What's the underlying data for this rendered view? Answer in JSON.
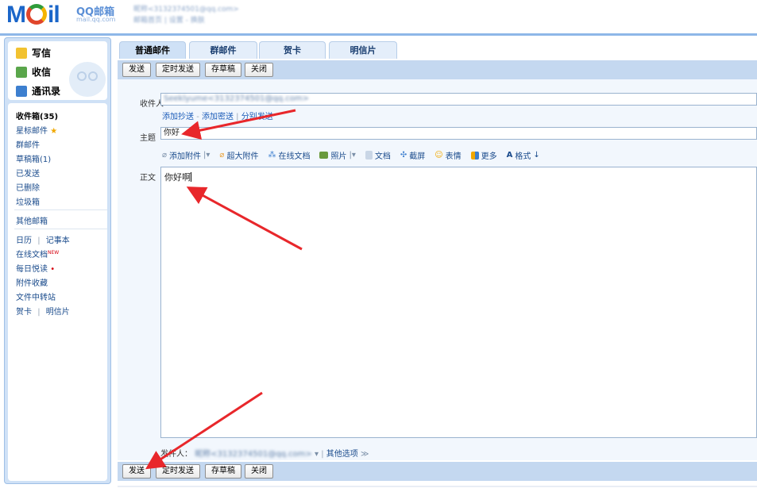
{
  "header": {
    "logo_text": "Mail",
    "logo_sub": "QQ邮箱",
    "logo_sub2": "mail.qq.com",
    "account": "昵称<3132374501@qq.com>",
    "account_links": "邮箱首页 | 设置 - 换肤"
  },
  "sidebar": {
    "compose": "写信",
    "inbox_btn": "收信",
    "contacts": "通讯录",
    "items": [
      {
        "label": "收件箱(35)"
      },
      {
        "label": "星标邮件"
      },
      {
        "label": "群邮件"
      },
      {
        "label": "草稿箱(1)"
      },
      {
        "label": "已发送"
      },
      {
        "label": "已删除"
      },
      {
        "label": "垃圾箱"
      },
      {
        "label": "其他邮箱"
      },
      {
        "label": "日历"
      },
      {
        "label": "记事本"
      },
      {
        "label": "在线文档"
      },
      {
        "label": "每日悦读"
      },
      {
        "label": "附件收藏"
      },
      {
        "label": "文件中转站"
      },
      {
        "label": "贺卡"
      },
      {
        "label": "明信片"
      }
    ],
    "new_badge": "NEW",
    "divider": "|"
  },
  "tabs": [
    "普通邮件",
    "群邮件",
    "贺卡",
    "明信片"
  ],
  "toolbar": {
    "send": "发送",
    "timed_send": "定时发送",
    "save_draft": "存草稿",
    "close": "关闭"
  },
  "form": {
    "to_label": "收件人",
    "to_value": "Seeklyume<3132374501@qq.com>",
    "cc_link": "添加抄送",
    "bcc_link": "添加密送",
    "separate_link": "分别发送",
    "subject_label": "主题",
    "subject_value": "你好",
    "body_label": "正文",
    "body_value": "你好啊",
    "format_tools": [
      "添加附件",
      "超大附件",
      "在线文档",
      "照片",
      "文档",
      "截屏",
      "表情",
      "更多",
      "格式"
    ],
    "sender_label": "发件人：",
    "sender_value": "昵称<3132374501@qq.com>",
    "other_options": "其他选项"
  },
  "colors": {
    "brand": "#1b66c9",
    "toolbar_bg": "#c4d8f0",
    "arrow": "#e8272b"
  }
}
